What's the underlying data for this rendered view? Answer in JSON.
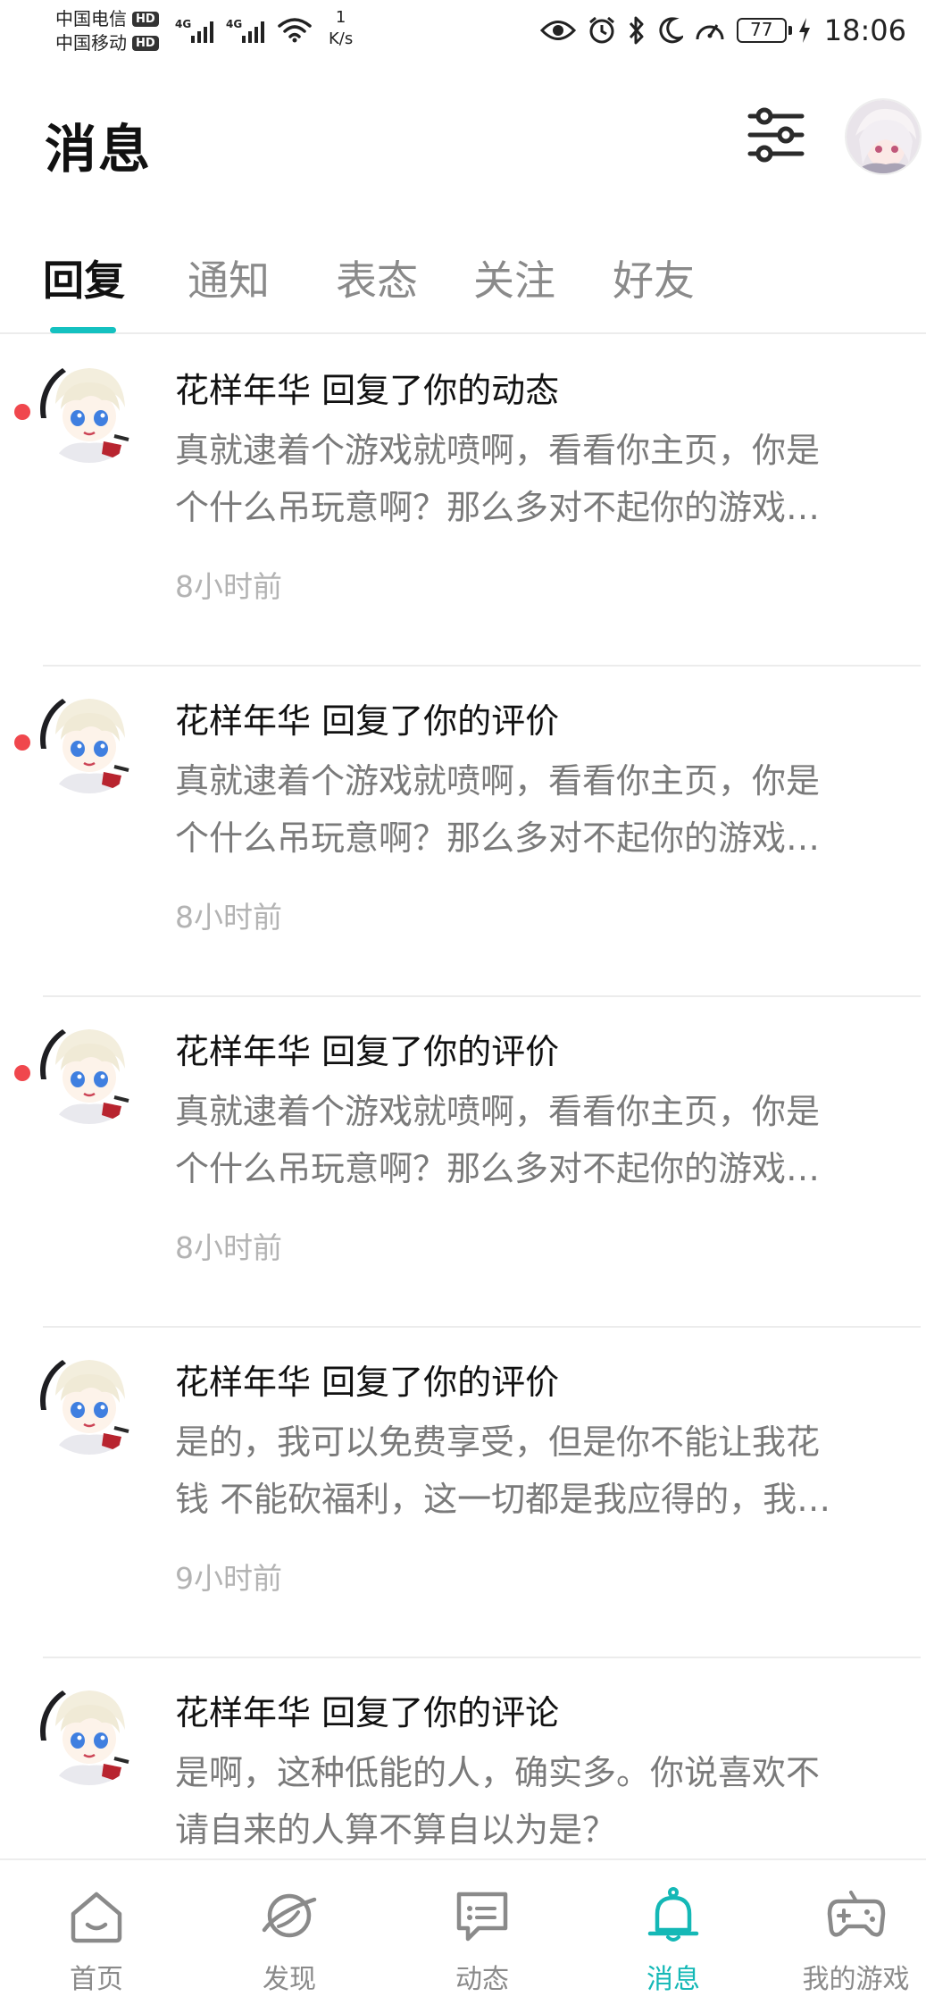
{
  "status_bar": {
    "carrier1": "中国电信",
    "carrier2": "中国移动",
    "hd": "HD",
    "net1": "4G",
    "net2": "4G",
    "speed_value": "1",
    "speed_unit": "K/s",
    "battery": "77",
    "time": "18:06"
  },
  "header": {
    "title": "消息",
    "filter_icon": "sliders-icon",
    "avatar": "user-avatar"
  },
  "tabs": [
    {
      "label": "回复",
      "active": true
    },
    {
      "label": "通知",
      "active": false
    },
    {
      "label": "表态",
      "active": false
    },
    {
      "label": "关注",
      "active": false
    },
    {
      "label": "好友",
      "active": false
    }
  ],
  "messages": [
    {
      "title": "花样年华 回复了你的动态",
      "line1": "真就逮着个游戏就喷啊，看看你主页，你是",
      "line2": "个什么吊玩意啊？那么多对不起你的游戏…",
      "time": "8小时前",
      "unread": true
    },
    {
      "title": "花样年华 回复了你的评价",
      "line1": "真就逮着个游戏就喷啊，看看你主页，你是",
      "line2": "个什么吊玩意啊？那么多对不起你的游戏…",
      "time": "8小时前",
      "unread": true
    },
    {
      "title": "花样年华 回复了你的评价",
      "line1": "真就逮着个游戏就喷啊，看看你主页，你是",
      "line2": "个什么吊玩意啊？那么多对不起你的游戏…",
      "time": "8小时前",
      "unread": true
    },
    {
      "title": "花样年华 回复了你的评价",
      "line1": "是的，我可以免费享受，但是你不能让我花",
      "line2": "钱 不能砍福利，这一切都是我应得的，我…",
      "time": "9小时前",
      "unread": false
    },
    {
      "title": "花样年华 回复了你的评论",
      "line1": "是啊，这种低能的人，确实多。你说喜欢不",
      "line2": "请自来的人算不算自以为是？",
      "time": "",
      "unread": false
    }
  ],
  "bottom_nav": [
    {
      "label": "首页",
      "icon": "home-icon",
      "active": false
    },
    {
      "label": "发现",
      "icon": "planet-icon",
      "active": false
    },
    {
      "label": "动态",
      "icon": "chat-icon",
      "active": false
    },
    {
      "label": "消息",
      "icon": "bell-icon",
      "active": true
    },
    {
      "label": "我的游戏",
      "icon": "gamepad-icon",
      "active": false
    }
  ],
  "colors": {
    "accent": "#14c1c0",
    "unread": "#f0474d"
  }
}
